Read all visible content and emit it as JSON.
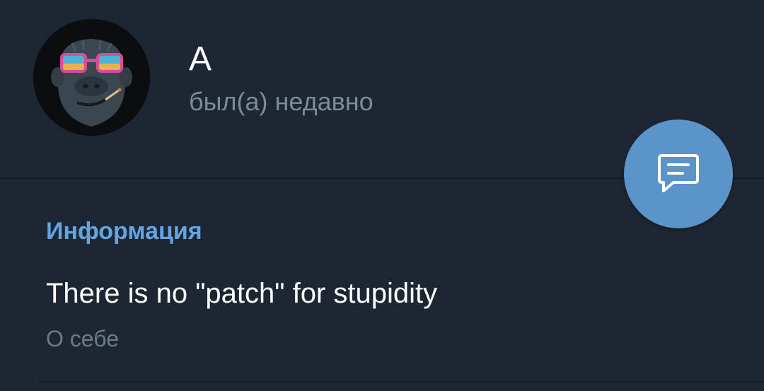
{
  "profile": {
    "name": "А",
    "status": "был(а) недавно",
    "avatar_icon": "gorilla-with-sunglasses-avatar"
  },
  "info": {
    "title": "Информация",
    "bio": "There is no \"patch\" for stupidity",
    "bio_caption": "О себе"
  },
  "fab": {
    "icon": "message-icon"
  },
  "colors": {
    "background": "#1d2733",
    "accent": "#64a5df",
    "fab": "#5a94c8",
    "secondary_text": "#7d8b99"
  }
}
